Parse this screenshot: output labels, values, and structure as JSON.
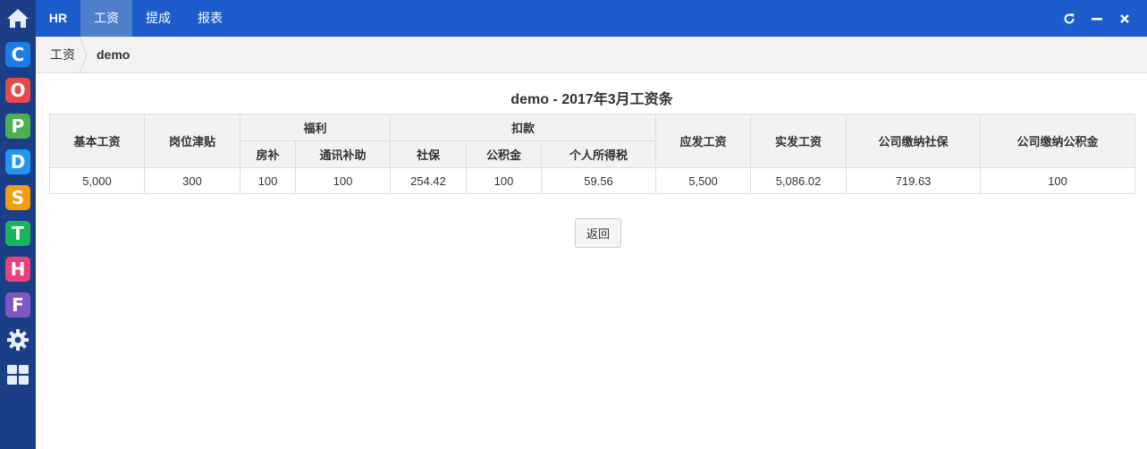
{
  "dock": {
    "apps": [
      {
        "icon": "c-app-icon",
        "letter": "C",
        "color": "#1b7de6"
      },
      {
        "icon": "o-app-icon",
        "letter": "O",
        "color": "#e84a4a"
      },
      {
        "icon": "p-app-icon",
        "letter": "P",
        "color": "#4caf50"
      },
      {
        "icon": "d-app-icon",
        "letter": "D",
        "color": "#2196f3"
      },
      {
        "icon": "s-app-icon",
        "letter": "S",
        "color": "#f39c12"
      },
      {
        "icon": "t-app-icon",
        "letter": "T",
        "color": "#17b55c"
      },
      {
        "icon": "h-app-icon",
        "letter": "H",
        "color": "#ec407a"
      },
      {
        "icon": "f-app-icon",
        "letter": "F",
        "color": "#7e57c2"
      }
    ]
  },
  "topbar": {
    "brand": "HR",
    "tabs": [
      "工资",
      "提成",
      "报表"
    ]
  },
  "breadcrumb": {
    "items": [
      "工资",
      "demo"
    ]
  },
  "page": {
    "title": "demo - 2017年3月工资条",
    "back_button": "返回"
  },
  "table": {
    "headers": {
      "base_salary": "基本工资",
      "post_allowance": "岗位津贴",
      "welfare": "福利",
      "housing": "房补",
      "communication": "通讯补助",
      "deduction": "扣款",
      "social_security": "社保",
      "housing_fund": "公积金",
      "income_tax": "个人所得税",
      "gross_pay": "应发工资",
      "net_pay": "实发工资",
      "company_social": "公司缴纳社保",
      "company_fund": "公司缴纳公积金"
    },
    "row": [
      "5,000",
      "300",
      "100",
      "100",
      "254.42",
      "100",
      "59.56",
      "5,500",
      "5,086.02",
      "719.63",
      "100"
    ]
  }
}
